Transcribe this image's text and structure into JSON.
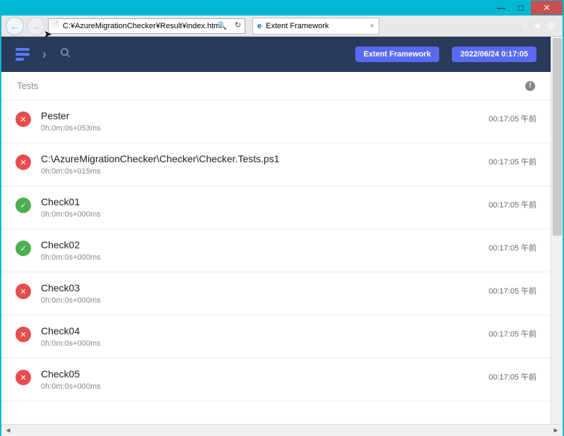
{
  "window": {
    "minimize": "—",
    "maximize": "□",
    "close": "✕"
  },
  "browser": {
    "url": "C:¥AzureMigrationChecker¥Result¥index.html",
    "tab_icon": "e",
    "tab_title": "Extent Framework",
    "search_glyph": "🔍",
    "refresh_glyph": "↻",
    "back_glyph": "←",
    "forward_glyph": "→",
    "home_glyph": "⌂",
    "star_glyph": "★",
    "gear_glyph": "⚙"
  },
  "header": {
    "chevron": "›",
    "search": "🔍",
    "label_framework": "Extent Framework",
    "timestamp": "2022/06/24 0:17:05"
  },
  "tests_header": {
    "label": "Tests",
    "info": "!"
  },
  "tests": [
    {
      "status": "fail",
      "name": "Pester",
      "duration": "0h:0m:0s+053ms",
      "time": "00:17:05 午前"
    },
    {
      "status": "fail",
      "name": "C:\\AzureMigrationChecker\\Checker\\Checker.Tests.ps1",
      "duration": "0h:0m:0s+015ms",
      "time": "00:17:05 午前"
    },
    {
      "status": "pass",
      "name": "Check01",
      "duration": "0h:0m:0s+000ms",
      "time": "00:17:05 午前"
    },
    {
      "status": "pass",
      "name": "Check02",
      "duration": "0h:0m:0s+000ms",
      "time": "00:17:05 午前"
    },
    {
      "status": "fail",
      "name": "Check03",
      "duration": "0h:0m:0s+000ms",
      "time": "00:17:05 午前"
    },
    {
      "status": "fail",
      "name": "Check04",
      "duration": "0h:0m:0s+000ms",
      "time": "00:17:05 午前"
    },
    {
      "status": "fail",
      "name": "Check05",
      "duration": "0h:0m:0s+000ms",
      "time": "00:17:05 午前"
    }
  ],
  "status_glyphs": {
    "fail": "✕",
    "pass": "✓"
  },
  "hscroll": {
    "left": "◄",
    "right": "►"
  }
}
